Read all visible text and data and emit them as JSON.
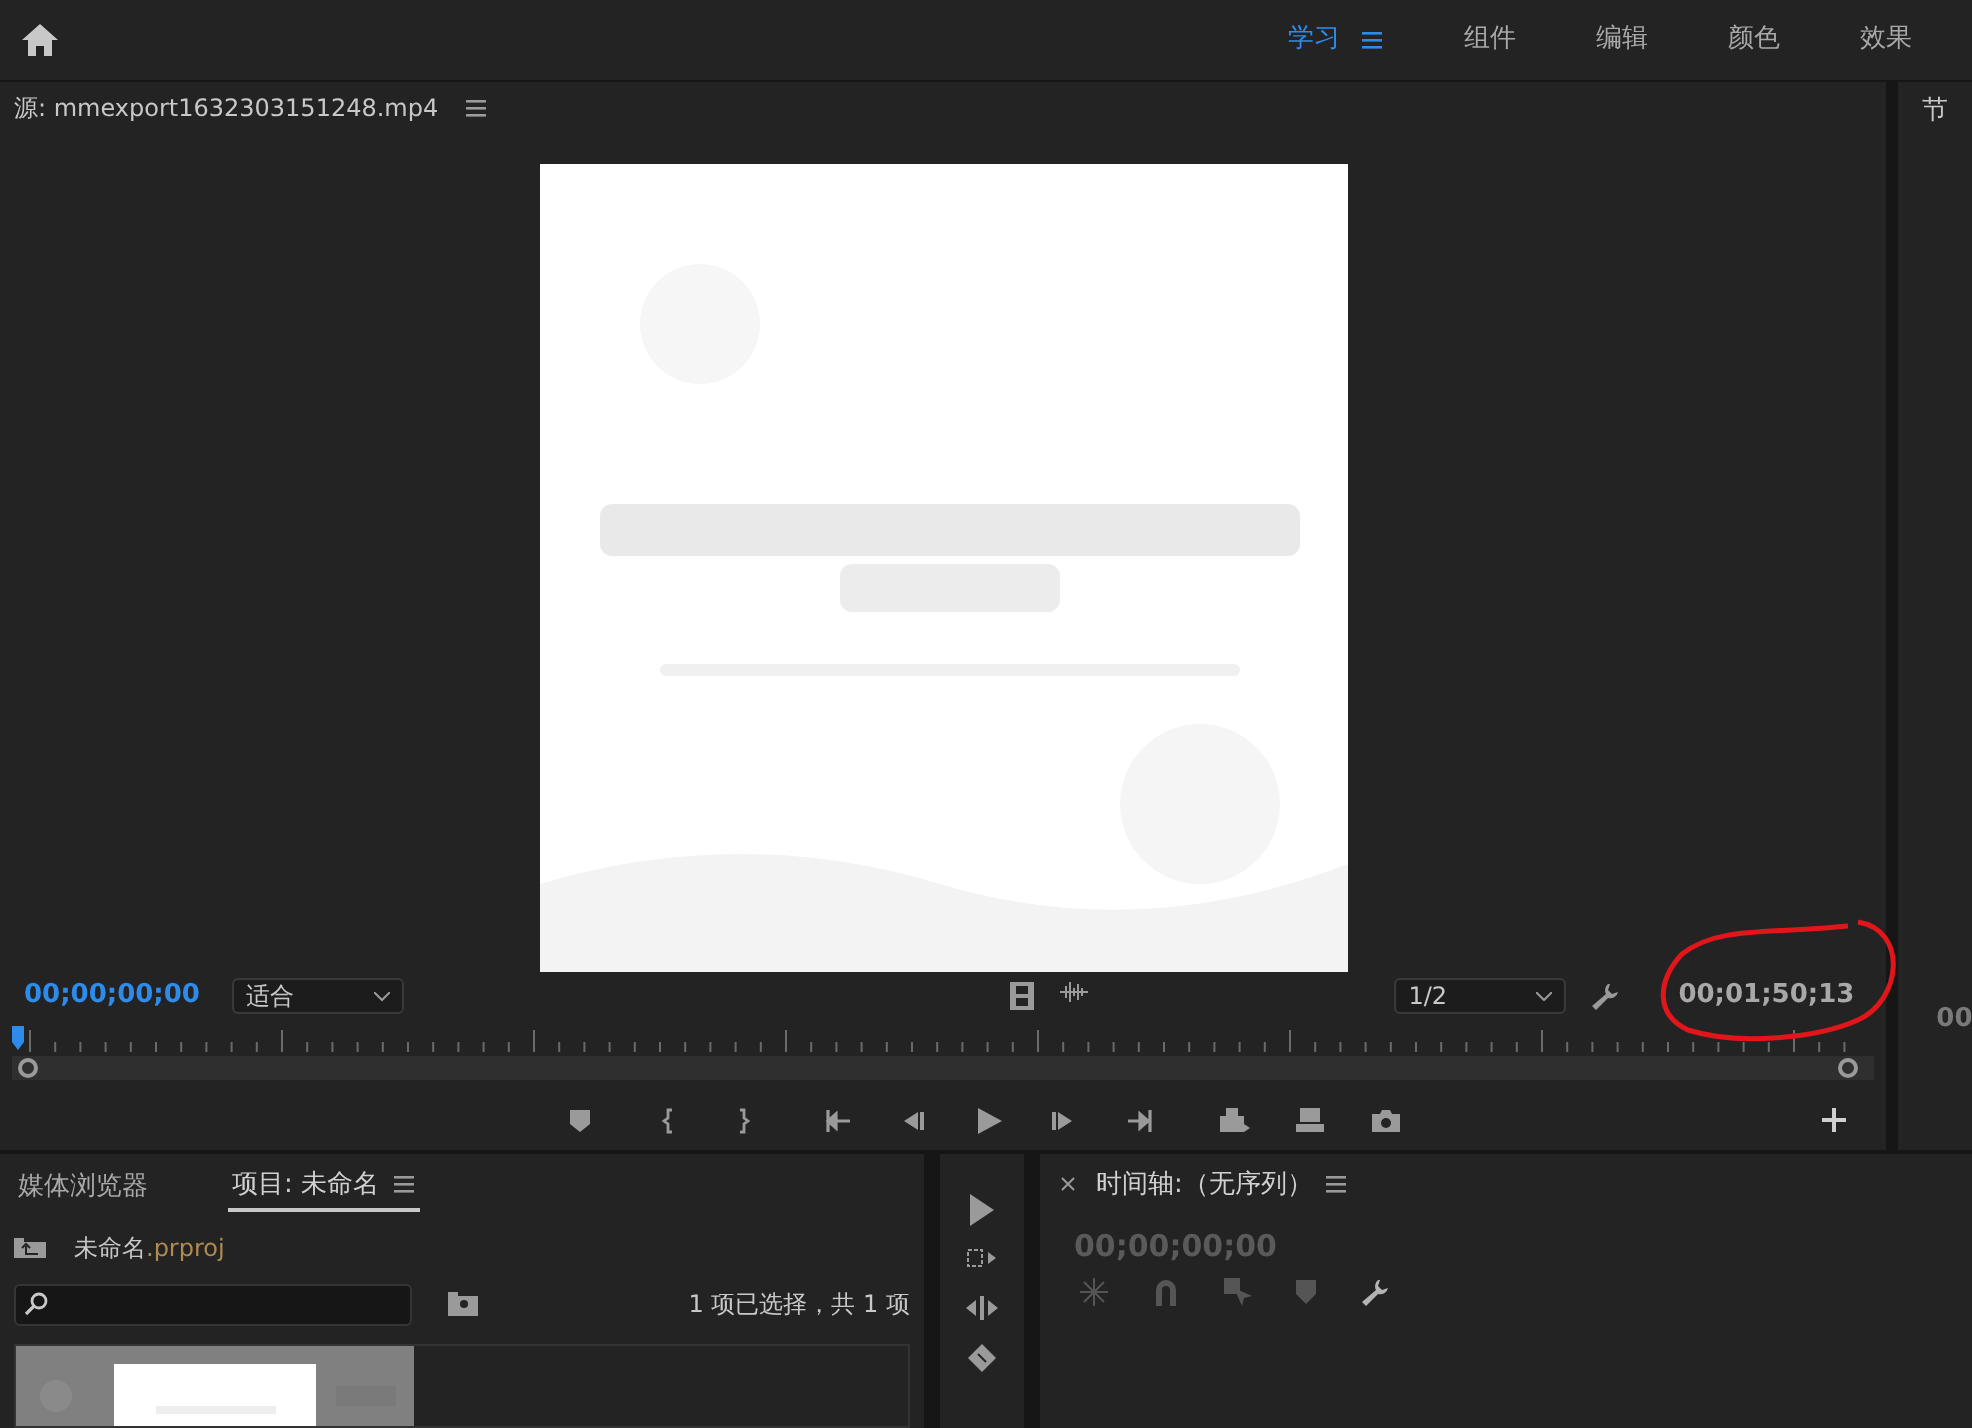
{
  "workspace_tabs": [
    {
      "label": "学习",
      "selected": true
    },
    {
      "label": "组件",
      "selected": false
    },
    {
      "label": "编辑",
      "selected": false
    },
    {
      "label": "颜色",
      "selected": false
    },
    {
      "label": "效果",
      "selected": false
    }
  ],
  "source_monitor": {
    "title": "源: mmexport1632303151248.mp4",
    "current_time": "00;00;00;00",
    "zoom": "适合",
    "resolution": "1/2",
    "duration": "00;01;50;13",
    "playhead": {
      "level": 0
    },
    "annotation": {
      "kind": "circle",
      "color": "#e0161b"
    }
  },
  "program_monitor": {
    "title": "节",
    "time": "00"
  },
  "project_panel": {
    "tabs": [
      {
        "label": "媒体浏览器",
        "selected": false
      },
      {
        "label": "项目: 未命名",
        "selected": true
      }
    ],
    "file": {
      "name": "未命名",
      "extension": ".prproj"
    },
    "selection_status": "1 项已选择，共 1 项"
  },
  "timeline": {
    "title": "时间轴:（无序列）",
    "time": "00;00;00;00"
  }
}
